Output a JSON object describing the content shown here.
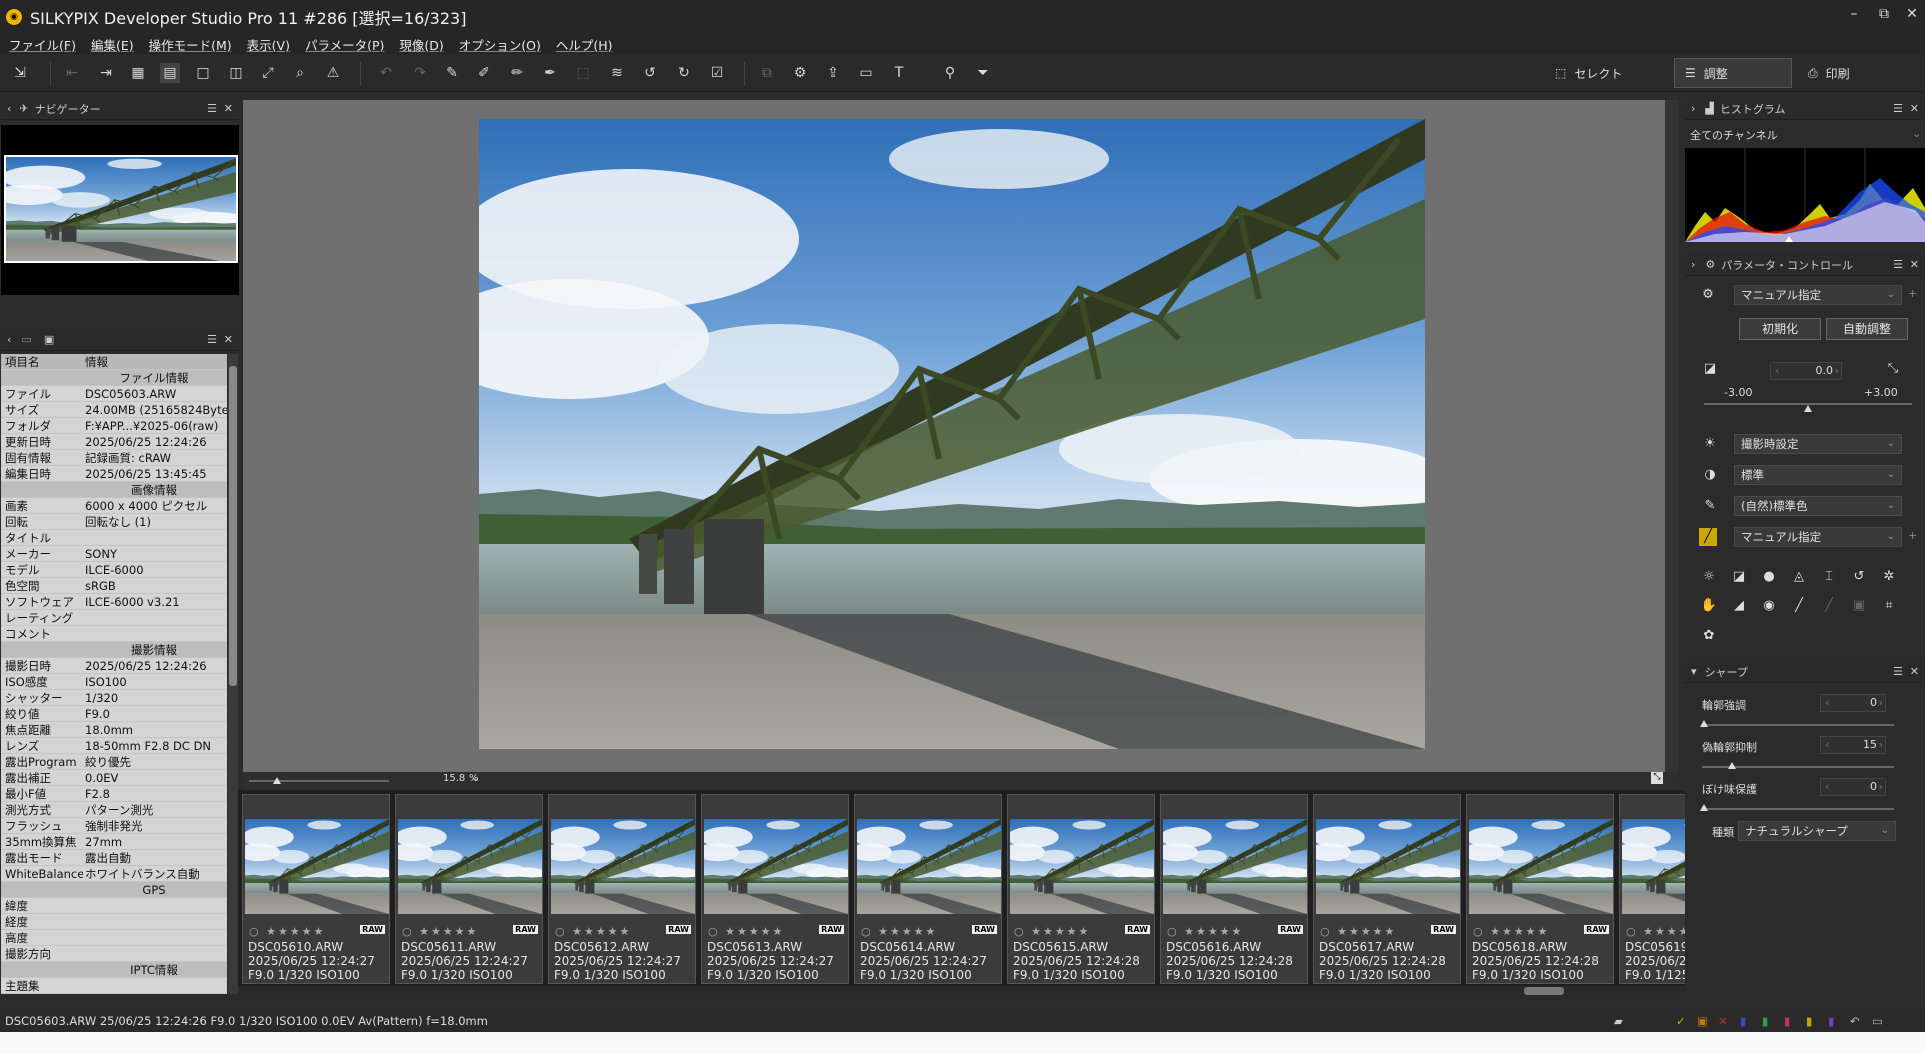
{
  "window": {
    "title": "SILKYPIX Developer Studio Pro 11   #286   [選択=16/323]"
  },
  "menu": [
    "ファイル(F)",
    "編集(E)",
    "操作モード(M)",
    "表示(V)",
    "パラメータ(P)",
    "現像(D)",
    "オプション(O)",
    "ヘルプ(H)"
  ],
  "modes": {
    "select": "セレクト",
    "adjust": "調整",
    "print": "印刷"
  },
  "navigator": {
    "title": "ナビゲーター"
  },
  "info": {
    "col_key": "項目名",
    "col_val": "情報",
    "rows": [
      {
        "type": "sect",
        "k": "",
        "v": "ファイル情報"
      },
      {
        "k": "ファイル",
        "v": "DSC05603.ARW"
      },
      {
        "k": "サイズ",
        "v": "24.00MB (25165824Byte"
      },
      {
        "k": "フォルダ",
        "v": "F:¥APP...¥2025-06(raw)"
      },
      {
        "k": "更新日時",
        "v": "2025/06/25 12:24:26"
      },
      {
        "k": "固有情報",
        "v": "記録画質: cRAW"
      },
      {
        "k": "編集日時",
        "v": "2025/06/25 13:45:45"
      },
      {
        "type": "sect",
        "k": "",
        "v": "画像情報"
      },
      {
        "k": "画素",
        "v": "6000 x 4000 ピクセル"
      },
      {
        "k": "回転",
        "v": "回転なし (1)"
      },
      {
        "k": "タイトル",
        "v": ""
      },
      {
        "k": "メーカー",
        "v": "SONY"
      },
      {
        "k": "モデル",
        "v": "ILCE-6000"
      },
      {
        "k": "色空間",
        "v": "sRGB"
      },
      {
        "k": "ソフトウェア",
        "v": "ILCE-6000 v3.21"
      },
      {
        "k": "レーティング",
        "v": ""
      },
      {
        "k": "コメント",
        "v": ""
      },
      {
        "type": "sect",
        "k": "",
        "v": "撮影情報"
      },
      {
        "k": "撮影日時",
        "v": "2025/06/25 12:24:26"
      },
      {
        "k": "ISO感度",
        "v": "ISO100"
      },
      {
        "k": "シャッター",
        "v": "1/320"
      },
      {
        "k": "絞り値",
        "v": "F9.0"
      },
      {
        "k": "焦点距離",
        "v": "18.0mm"
      },
      {
        "k": "レンズ",
        "v": "18-50mm F2.8 DC DN"
      },
      {
        "k": "露出Program",
        "v": "絞り優先"
      },
      {
        "k": "露出補正",
        "v": "0.0EV"
      },
      {
        "k": "最小F値",
        "v": "F2.8"
      },
      {
        "k": "測光方式",
        "v": "パターン測光"
      },
      {
        "k": "フラッシュ",
        "v": "強制非発光"
      },
      {
        "k": "35mm換算焦",
        "v": "27mm"
      },
      {
        "k": "露出モード",
        "v": "露出自動"
      },
      {
        "k": "WhiteBalance",
        "v": "ホワイトバランス自動"
      },
      {
        "type": "sect",
        "k": "",
        "v": "GPS"
      },
      {
        "k": "緯度",
        "v": ""
      },
      {
        "k": "経度",
        "v": ""
      },
      {
        "k": "高度",
        "v": ""
      },
      {
        "k": "撮影方向",
        "v": ""
      },
      {
        "type": "sect",
        "k": "",
        "v": "IPTC情報"
      },
      {
        "k": "主題集",
        "v": ""
      }
    ]
  },
  "viewer": {
    "zoom": "15.8",
    "zoom_unit": "%"
  },
  "film": [
    {
      "name": "DSC05610.ARW",
      "date": "2025/06/25 12:24:27",
      "exif": "F9.0 1/320 ISO100"
    },
    {
      "name": "DSC05611.ARW",
      "date": "2025/06/25 12:24:27",
      "exif": "F9.0 1/320 ISO100"
    },
    {
      "name": "DSC05612.ARW",
      "date": "2025/06/25 12:24:27",
      "exif": "F9.0 1/320 ISO100"
    },
    {
      "name": "DSC05613.ARW",
      "date": "2025/06/25 12:24:27",
      "exif": "F9.0 1/320 ISO100"
    },
    {
      "name": "DSC05614.ARW",
      "date": "2025/06/25 12:24:27",
      "exif": "F9.0 1/320 ISO100"
    },
    {
      "name": "DSC05615.ARW",
      "date": "2025/06/25 12:24:28",
      "exif": "F9.0 1/320 ISO100"
    },
    {
      "name": "DSC05616.ARW",
      "date": "2025/06/25 12:24:28",
      "exif": "F9.0 1/320 ISO100"
    },
    {
      "name": "DSC05617.ARW",
      "date": "2025/06/25 12:24:28",
      "exif": "F9.0 1/320 ISO100"
    },
    {
      "name": "DSC05618.ARW",
      "date": "2025/06/25 12:24:28",
      "exif": "F9.0 1/320 ISO100"
    },
    {
      "name": "DSC05619",
      "date": "2025/06/2",
      "exif": "F9.0 1/125"
    }
  ],
  "raw_badge": "RAW",
  "stars": "○ ★★★★★",
  "histogram": {
    "title": "ヒストグラム",
    "channel": "全てのチャンネル"
  },
  "param_control": {
    "title": "パラメータ・コントロール",
    "preset": "マニュアル指定",
    "init": "初期化",
    "auto": "自動調整",
    "exposure_value": "0.0",
    "exposure_min": "-3.00",
    "exposure_max": "+3.00",
    "wb": "撮影時設定",
    "tone": "標準",
    "color": "(自然)標準色",
    "tone_curve": "マニュアル指定"
  },
  "sharp": {
    "title": "シャープ",
    "edge_label": "輪郭強調",
    "edge_value": "0",
    "false_label": "偽輪郭抑制",
    "false_value": "15",
    "blur_label": "ぼけ味保護",
    "blur_value": "0",
    "type_label": "種類",
    "type_value": "ナチュラルシャープ"
  },
  "status": {
    "text": "DSC05603.ARW 25/06/25 12:24:26 F9.0 1/320 ISO100  0.0EV Av(Pattern) f=18.0mm"
  },
  "colors": {
    "bg": "#2b2b2b",
    "viewer": "#707070",
    "accent": "#f2b400"
  }
}
